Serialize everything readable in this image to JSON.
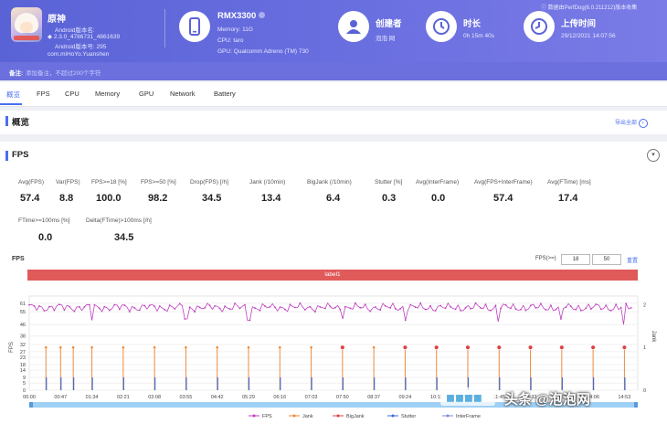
{
  "app": {
    "name": "原神",
    "android_version_label": "Android版本名:",
    "android_version": "2.3.0_4786731_4861639",
    "android_code": "Android版本号: 295",
    "package": "com.miHoYo.Yuanshen"
  },
  "device": {
    "model": "RMX3300",
    "memory": "Memory: 11G",
    "cpu": "CPU: taro",
    "gpu": "GPU: Qualcomm Adreno (TM) 730"
  },
  "creator": {
    "label": "创建者",
    "value": "泡泡 网"
  },
  "duration": {
    "label": "时长",
    "value": "0h 15m 40s"
  },
  "upload": {
    "label": "上传时间",
    "value": "29/12/2021 14:07:56"
  },
  "version_note": "数据由PerfDog(6.0.211212)版本收集",
  "remark": {
    "label": "备注:",
    "placeholder": "添加备注，不超过200个字符"
  },
  "tabs": [
    "概览",
    "FPS",
    "CPU",
    "Memory",
    "GPU",
    "Network",
    "Battery"
  ],
  "overview": {
    "title": "概览",
    "export": "导出全部"
  },
  "fps_section": {
    "title": "FPS",
    "metrics_row1": [
      {
        "label": "Avg(FPS)",
        "value": "57.4"
      },
      {
        "label": "Var(FPS)",
        "value": "8.8"
      },
      {
        "label": "FPS>=18 [%]",
        "value": "100.0"
      },
      {
        "label": "FPS>=50 [%]",
        "value": "98.2"
      },
      {
        "label": "Drop(FPS) [/h]",
        "value": "34.5"
      },
      {
        "label": "Jank (/10min)",
        "value": "13.4"
      },
      {
        "label": "BigJank (/10min)",
        "value": "6.4"
      },
      {
        "label": "Stutter [%]",
        "value": "0.3"
      },
      {
        "label": "Avg(InterFrame)",
        "value": "0.0"
      },
      {
        "label": "Avg(FPS+InterFrame)",
        "value": "57.4"
      },
      {
        "label": "Avg(FTime) [ms]",
        "value": "17.4"
      }
    ],
    "metrics_row2": [
      {
        "label": "FTime>=100ms [%]",
        "value": "0.0"
      },
      {
        "label": "Delta(FTime)>100ms [/h]",
        "value": "34.5"
      }
    ]
  },
  "chart_controls": {
    "filter_label": "FPS(>=)",
    "min": "18",
    "max": "50",
    "reset": "重置"
  },
  "watermark": "头条 @泡泡网",
  "chart_data": {
    "type": "line",
    "title": "FPS",
    "band_label": "label1",
    "y_left": {
      "label": "FPS",
      "ticks": [
        0,
        5,
        9,
        14,
        18,
        23,
        27,
        32,
        38,
        46,
        55,
        61
      ],
      "ylim": [
        0,
        66
      ]
    },
    "y_right": {
      "label": "Jank",
      "ticks": [
        0,
        1,
        2
      ],
      "ylim": [
        0,
        2.2
      ]
    },
    "x_ticks": [
      "00:00",
      "00:47",
      "01:34",
      "02:21",
      "03:08",
      "03:55",
      "04:42",
      "05:29",
      "06:16",
      "07:03",
      "07:50",
      "08:37",
      "09:24",
      "10:11",
      "10:58",
      "11:45",
      "12:32",
      "13:19",
      "14:06",
      "14:53"
    ],
    "fps_series": {
      "name": "FPS",
      "color": "#c040c0",
      "mean": 57.4,
      "baseline_range": [
        55,
        61
      ],
      "dips": [
        {
          "t": "01:34",
          "v": 49
        },
        {
          "t": "03:55",
          "v": 50
        },
        {
          "t": "05:29",
          "v": 49
        },
        {
          "t": "07:50",
          "v": 50
        },
        {
          "t": "09:24",
          "v": 49
        },
        {
          "t": "11:45",
          "v": 48
        },
        {
          "t": "13:19",
          "v": 50
        },
        {
          "t": "14:53",
          "v": 46
        }
      ]
    },
    "jank_times": [
      "00:25",
      "00:47",
      "01:06",
      "01:34",
      "02:21",
      "03:08",
      "03:55",
      "04:42",
      "05:29",
      "06:16",
      "07:03",
      "07:50",
      "08:37",
      "09:24",
      "10:11",
      "10:58",
      "11:45",
      "12:32",
      "13:19",
      "14:06",
      "14:53"
    ],
    "bigjank_times": [
      "07:50",
      "09:24",
      "10:11",
      "10:58",
      "11:45",
      "12:32",
      "13:19",
      "14:06",
      "14:53"
    ],
    "legend": [
      {
        "name": "FPS",
        "color": "#c040c0"
      },
      {
        "name": "Jank",
        "color": "#f08a3a"
      },
      {
        "name": "BigJank",
        "color": "#e04040"
      },
      {
        "name": "Stutter",
        "color": "#3a6ad8"
      },
      {
        "name": "InterFrame",
        "color": "#7a8ad8"
      }
    ]
  },
  "colors": {
    "header": "#5a63d6",
    "accent": "#4a6ff0",
    "label_band": "#e05a5a"
  }
}
